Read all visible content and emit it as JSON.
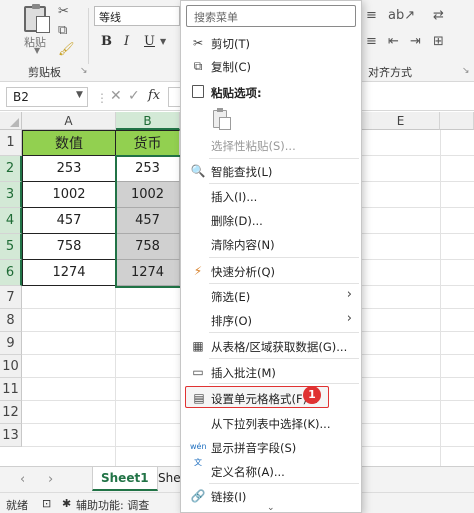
{
  "ribbon": {
    "paste_label": "粘贴",
    "clipboard_group": "剪贴板",
    "font_name": "等线",
    "bold": "B",
    "italic": "I",
    "underline": "U",
    "alignment_group": "对齐方式"
  },
  "formula_bar": {
    "name_box": "B2",
    "fx": "fx"
  },
  "grid": {
    "columns": [
      "A",
      "B",
      "E"
    ],
    "rows": [
      "1",
      "2",
      "3",
      "4",
      "5",
      "6",
      "7",
      "8",
      "9",
      "10",
      "11",
      "12",
      "13"
    ],
    "header_a": "数值",
    "header_b": "货币",
    "col_a": [
      "253",
      "1002",
      "457",
      "758",
      "1274"
    ],
    "col_b": [
      "253",
      "1002",
      "457",
      "758",
      "1274"
    ],
    "header_color": "#92D050",
    "selection_color": "#217346"
  },
  "sheet_tabs": {
    "tab1": "Sheet1",
    "tab2": "She"
  },
  "status_bar": {
    "ready": "就绪",
    "accessibility": "辅助功能: 调查"
  },
  "context_menu": {
    "search_placeholder": "搜索菜单",
    "cut": "剪切(T)",
    "copy": "复制(C)",
    "paste_options": "粘贴选项:",
    "paste_special": "选择性粘贴(S)...",
    "smart_lookup": "智能查找(L)",
    "insert": "插入(I)...",
    "delete": "删除(D)...",
    "clear_contents": "清除内容(N)",
    "quick_analysis": "快速分析(Q)",
    "filter": "筛选(E)",
    "sort": "排序(O)",
    "get_data": "从表格/区域获取数据(G)...",
    "insert_comment": "插入批注(M)",
    "format_cells": "设置单元格格式(F)...",
    "pick_from_list": "从下拉列表中选择(K)...",
    "phonetic": "显示拼音字段(S)",
    "define_name": "定义名称(A)...",
    "link": "链接(I)",
    "badge": "1"
  }
}
